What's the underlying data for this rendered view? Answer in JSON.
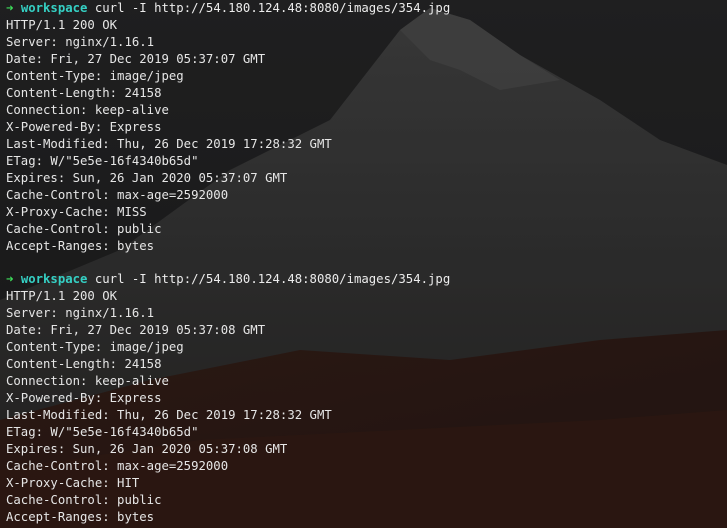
{
  "terminal": {
    "colors": {
      "prompt_arrow": "#3ddc5a",
      "prompt_dir": "#35d0c4",
      "text": "#e6e6e6"
    },
    "blocks": [
      {
        "prompt": {
          "arrow": "➜",
          "dir": "workspace",
          "command": "curl -I http://54.180.124.48:8080/images/354.jpg"
        },
        "lines": [
          "HTTP/1.1 200 OK",
          "Server: nginx/1.16.1",
          "Date: Fri, 27 Dec 2019 05:37:07 GMT",
          "Content-Type: image/jpeg",
          "Content-Length: 24158",
          "Connection: keep-alive",
          "X-Powered-By: Express",
          "Last-Modified: Thu, 26 Dec 2019 17:28:32 GMT",
          "ETag: W/\"5e5e-16f4340b65d\"",
          "Expires: Sun, 26 Jan 2020 05:37:07 GMT",
          "Cache-Control: max-age=2592000",
          "X-Proxy-Cache: MISS",
          "Cache-Control: public",
          "Accept-Ranges: bytes"
        ]
      },
      {
        "prompt": {
          "arrow": "➜",
          "dir": "workspace",
          "command": "curl -I http://54.180.124.48:8080/images/354.jpg"
        },
        "lines": [
          "HTTP/1.1 200 OK",
          "Server: nginx/1.16.1",
          "Date: Fri, 27 Dec 2019 05:37:08 GMT",
          "Content-Type: image/jpeg",
          "Content-Length: 24158",
          "Connection: keep-alive",
          "X-Powered-By: Express",
          "Last-Modified: Thu, 26 Dec 2019 17:28:32 GMT",
          "ETag: W/\"5e5e-16f4340b65d\"",
          "Expires: Sun, 26 Jan 2020 05:37:08 GMT",
          "Cache-Control: max-age=2592000",
          "X-Proxy-Cache: HIT",
          "Cache-Control: public",
          "Accept-Ranges: bytes"
        ]
      }
    ]
  }
}
